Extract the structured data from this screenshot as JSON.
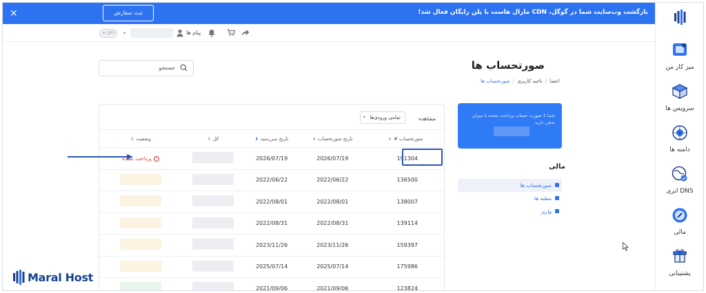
{
  "banner": {
    "message": "بازگشت وب‌سایت شما در گوگل، CDN مارال هاست با پلن رایگان فعال شد!",
    "cta": "ثبت سفارش",
    "close": "✕"
  },
  "topbar": {
    "toggle": "OFF",
    "messages": "پیام ها"
  },
  "search": {
    "placeholder": "جستجو"
  },
  "page": {
    "title": "صورتحساب ها",
    "breadcrumb": {
      "home": "اعضا",
      "sep": "/",
      "area": "ناحیه کاربری",
      "current": "صورتحساب ها"
    }
  },
  "balance_card": {
    "text": "شما 1 صورت حساب پرداخت نشده با میزان بدهی دارید."
  },
  "finance": {
    "title": "مالی",
    "items": [
      {
        "label": "صورتحساب ها",
        "active": true
      },
      {
        "label": "مظنه ها",
        "active": false
      },
      {
        "label": "واریز",
        "active": false
      }
    ]
  },
  "table": {
    "view_label": "مشاهده",
    "view_value": "تمامی ورودی‌ها",
    "columns": [
      "صورتحساب #",
      "تاریخ صورتحساب",
      "تاریخ سررسید",
      "کل",
      "وضعیت"
    ],
    "rows": [
      {
        "id": "191304",
        "date": "2026/07/19",
        "due": "2026/07/19",
        "status": "پرداخت نشده",
        "status_kind": "unpaid"
      },
      {
        "id": "136500",
        "date": "2022/06/22",
        "due": "2022/06/22",
        "status": "",
        "status_kind": "blur-y"
      },
      {
        "id": "138007",
        "date": "2022/08/01",
        "due": "2022/08/01",
        "status": "",
        "status_kind": "blur-y"
      },
      {
        "id": "139114",
        "date": "2022/08/31",
        "due": "2022/08/31",
        "status": "",
        "status_kind": "blur-y"
      },
      {
        "id": "159397",
        "date": "2023/11/26",
        "due": "2023/11/26",
        "status": "",
        "status_kind": "blur-y"
      },
      {
        "id": "175986",
        "date": "2025/07/14",
        "due": "2025/07/14",
        "status": "",
        "status_kind": "blur-y"
      },
      {
        "id": "123824",
        "date": "2021/09/06",
        "due": "2021/09/06",
        "status": "",
        "status_kind": "blur-g"
      }
    ]
  },
  "sidebar": {
    "items": [
      {
        "label": "میز کار من",
        "icon": "desktop-icon"
      },
      {
        "label": "سرویس ها",
        "icon": "box-icon"
      },
      {
        "label": "دامنه ها",
        "icon": "globe-icon"
      },
      {
        "label": "DNS ابری",
        "icon": "dns-globe-icon"
      },
      {
        "label": "مالی",
        "icon": "finance-icon"
      },
      {
        "label": "پشتیبانی",
        "icon": "support-icon"
      }
    ]
  },
  "brand": {
    "name": "Maral Host"
  },
  "colors": {
    "primary": "#2d72f1",
    "unpaid": "#d0312d",
    "annotation": "#2b54b8"
  }
}
